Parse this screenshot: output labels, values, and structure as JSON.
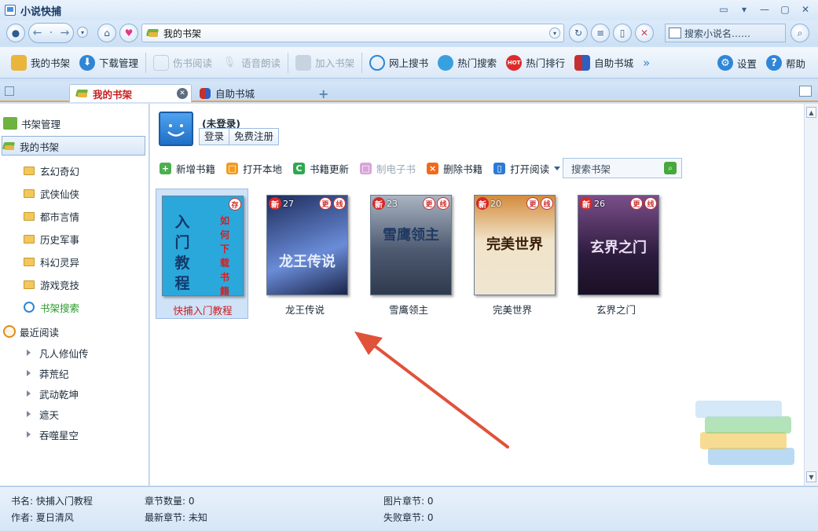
{
  "app": {
    "title": "小说快捕"
  },
  "address": {
    "value": "我的书架"
  },
  "top_search": {
    "placeholder": "搜索小说名……"
  },
  "toolbar": {
    "items": [
      {
        "label": "我的书架",
        "enabled": true
      },
      {
        "label": "下载管理",
        "enabled": true
      },
      {
        "label": "伤书阅读",
        "enabled": false
      },
      {
        "label": "语音朗读",
        "enabled": false
      },
      {
        "label": "加入书架",
        "enabled": false
      },
      {
        "label": "网上搜书",
        "enabled": true
      },
      {
        "label": "热门搜索",
        "enabled": true
      },
      {
        "label": "热门排行",
        "enabled": true,
        "hot_badge": "HOT"
      },
      {
        "label": "自助书城",
        "enabled": true
      }
    ],
    "more": "»",
    "settings": "设置",
    "help": "帮助"
  },
  "tabs": [
    {
      "label": "我的书架",
      "active": true
    },
    {
      "label": "自助书城",
      "active": false
    }
  ],
  "sidebar": {
    "shelf_manage": "书架管理",
    "my_shelf": "我的书架",
    "categories": [
      "玄幻奇幻",
      "武侠仙侠",
      "都市言情",
      "历史军事",
      "科幻灵异",
      "游戏竞技"
    ],
    "search": "书架搜索",
    "recent_label": "最近阅读",
    "recent": [
      "凡人修仙传",
      "莽荒纪",
      "武动乾坤",
      "遮天",
      "吞噬星空"
    ]
  },
  "user": {
    "status": "(未登录)",
    "login": "登录",
    "register": "免费注册"
  },
  "actions": [
    {
      "label": "新增书籍",
      "enabled": true,
      "color": "#4caf50",
      "glyph": "+"
    },
    {
      "label": "打开本地",
      "enabled": true,
      "color": "#f29b1e",
      "glyph": "□"
    },
    {
      "label": "书籍更新",
      "enabled": true,
      "color": "#2fa84f",
      "glyph": "C"
    },
    {
      "label": "制电子书",
      "enabled": false,
      "color": "#d9a3d9",
      "glyph": "□"
    },
    {
      "label": "删除书籍",
      "enabled": true,
      "color": "#f06a1a",
      "glyph": "×"
    },
    {
      "label": "打开阅读",
      "enabled": true,
      "color": "#2b7bd6",
      "glyph": "▯"
    }
  ],
  "shelf_search": {
    "placeholder": "搜索书架"
  },
  "books": [
    {
      "title": "快捕入门教程",
      "selected": true,
      "cover": {
        "type": "tutorial",
        "big": [
          "入",
          "门",
          "教",
          "程"
        ],
        "red": [
          "如",
          "何",
          "下",
          "载",
          "书",
          "籍"
        ],
        "stamp": "存"
      }
    },
    {
      "title": "龙王传说",
      "new_badge": "新",
      "count": "27",
      "flags": [
        "更",
        "线"
      ],
      "cover_color": [
        "#1d2c5c",
        "#6a8cd8"
      ],
      "cover_text": "龙王传说"
    },
    {
      "title": "雪鹰领主",
      "new_badge": "新",
      "count": "23",
      "flags": [
        "更",
        "线"
      ],
      "cover_color": [
        "#2f3a4e",
        "#a9b4c2"
      ],
      "cover_text": "雪鹰领主"
    },
    {
      "title": "完美世界",
      "new_badge": "新",
      "count": "20",
      "flags": [
        "更",
        "线"
      ],
      "cover_color": [
        "#f0e3c8",
        "#d38b3c"
      ],
      "cover_text": "完美世界"
    },
    {
      "title": "玄界之门",
      "new_badge": "新",
      "count": "26",
      "flags": [
        "更",
        "线"
      ],
      "cover_color": [
        "#2d1b3e",
        "#7a4f8a"
      ],
      "cover_text": "玄界之门"
    }
  ],
  "status": {
    "book_name_label": "书名:",
    "book_name": "快捕入门教程",
    "author_label": "作者:",
    "author": "夏日清风",
    "chapter_count_label": "章节数量:",
    "chapter_count": "0",
    "latest_chapter_label": "最新章节:",
    "latest_chapter": "未知",
    "image_chapters_label": "图片章节:",
    "image_chapters": "0",
    "failed_chapters_label": "失败章节:",
    "failed_chapters": "0"
  }
}
